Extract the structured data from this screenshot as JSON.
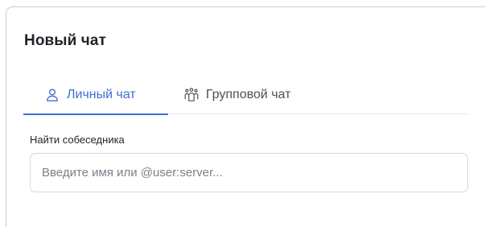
{
  "dialog": {
    "title": "Новый чат",
    "tabs": [
      {
        "label": "Личный чат",
        "icon": "user-icon",
        "active": true
      },
      {
        "label": "Групповой чат",
        "icon": "group-icon",
        "active": false
      }
    ],
    "search": {
      "label": "Найти собеседника",
      "placeholder": "Введите имя или @user:server...",
      "value": ""
    }
  },
  "colors": {
    "accent": "#3f6fd1",
    "text": "#1f2328",
    "muted": "#7b818a",
    "border": "#d6d9de"
  }
}
